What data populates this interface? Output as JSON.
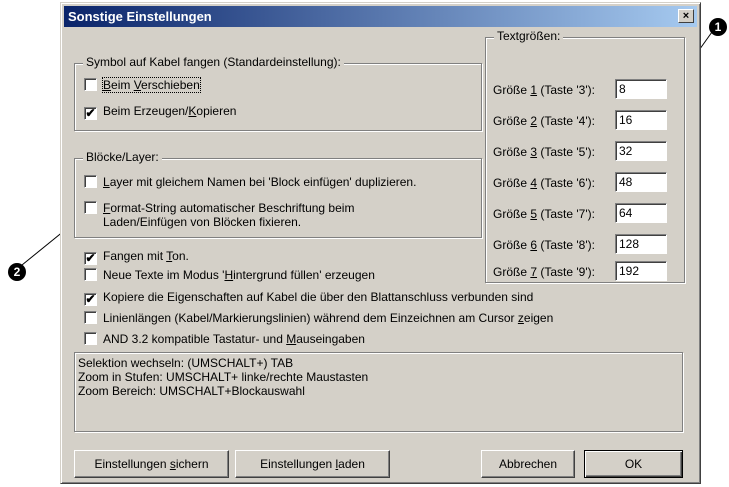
{
  "window": {
    "title": "Sonstige Einstellungen",
    "close_symbol": "×"
  },
  "symbol_group": {
    "title": "Symbol auf Kabel fangen (Standardeinstellung):",
    "items": [
      {
        "pre": "",
        "u": "B",
        "post": "eim ",
        "u2": "V",
        "post2": "erschieben",
        "checked": false
      },
      {
        "pre": "Beim Erzeugen/",
        "u": "K",
        "post": "opieren",
        "u2": "",
        "post2": "",
        "checked": true
      }
    ]
  },
  "bloecke_group": {
    "title": "Blöcke/Layer:",
    "items": [
      {
        "u": "L",
        "text": "ayer mit gleichem Namen bei 'Block einfügen' duplizieren.",
        "checked": false
      },
      {
        "u": "F",
        "text": "ormat-String automatischer Beschriftung beim",
        "line2": "Laden/Einfügen von Blöcken fixieren.",
        "checked": false
      }
    ]
  },
  "options": [
    {
      "pre": "Fangen mit ",
      "u": "T",
      "post": "on.",
      "checked": true
    },
    {
      "pre": "Neue Texte im Modus '",
      "u": "H",
      "post": "intergrund füllen' erzeugen",
      "checked": false
    },
    {
      "pre": "Kopiere die Eigenschaften auf Kabel die über den Blattanschluss verbunden sind",
      "u": "",
      "post": "",
      "checked": true
    },
    {
      "pre": "Linienlängen (Kabel/Markierungslinien) während dem Einzeichnen am Cursor ",
      "u": "z",
      "post": "eigen",
      "checked": false
    },
    {
      "pre": "AND 3.2 kompatible Tastatur- und ",
      "u": "M",
      "post": "auseingaben",
      "checked": false
    }
  ],
  "textsizes": {
    "title": "Textgrößen:",
    "items": [
      {
        "pre": "Größe ",
        "u": "1",
        "post": " (Taste '3'):",
        "value": "8"
      },
      {
        "pre": "Größe ",
        "u": "2",
        "post": " (Taste '4'):",
        "value": "16"
      },
      {
        "pre": "Größe ",
        "u": "3",
        "post": " (Taste '5'):",
        "value": "32"
      },
      {
        "pre": "Größe ",
        "u": "4",
        "post": " (Taste '6'):",
        "value": "48"
      },
      {
        "pre": "Größe ",
        "u": "5",
        "post": " (Taste '7'):",
        "value": "64"
      },
      {
        "pre": "Größe ",
        "u": "6",
        "post": " (Taste '8'):",
        "value": "128"
      },
      {
        "pre": "Größe ",
        "u": "7",
        "post": " (Taste '9'):",
        "value": "192"
      }
    ]
  },
  "info_lines": [
    "Selektion wechseln: (UMSCHALT+) TAB",
    "Zoom in Stufen: UMSCHALT+ linke/rechte Maustasten",
    "Zoom Bereich: UMSCHALT+Blockauswahl"
  ],
  "buttons": {
    "save_pre": "Einstellungen ",
    "save_u": "s",
    "save_post": "ichern",
    "load_pre": "Einstellungen ",
    "load_u": "l",
    "load_post": "aden",
    "cancel": "Abbrechen",
    "ok": "OK"
  },
  "callouts": {
    "one": "1",
    "two": "2"
  },
  "checkmark": "✔"
}
